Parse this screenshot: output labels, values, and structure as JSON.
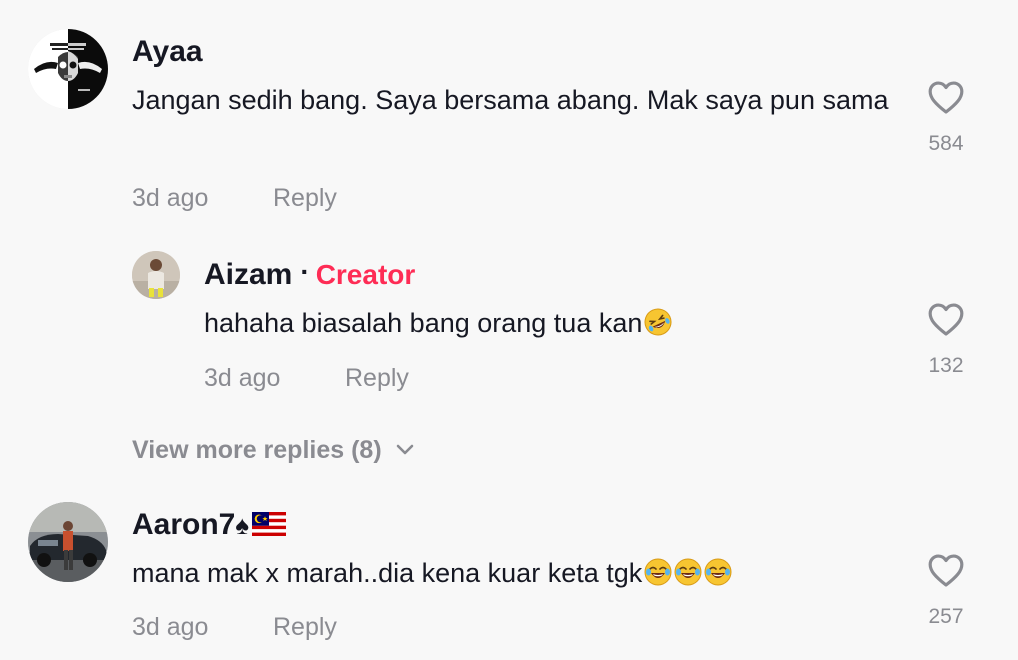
{
  "comments": [
    {
      "username": "Ayaa",
      "text": "Jangan sedih bang. Saya bersama abang. Mak saya pun sama",
      "time": "3d ago",
      "reply_label": "Reply",
      "likes": "584",
      "avatar_icon": "avenged-sevenfold-deathbat-avatar"
    },
    {
      "username": "Aizam",
      "separator": "·",
      "creator_label": "Creator",
      "text": "hahaha biasalah bang orang tua kan",
      "text_emojis": [
        "rolling-on-floor-laughing-emoji"
      ],
      "time": "3d ago",
      "reply_label": "Reply",
      "likes": "132",
      "avatar_icon": "person-photo-avatar"
    },
    {
      "username": "Aaron7",
      "username_suffix": "♠",
      "username_flag": "malaysia-flag-emoji",
      "text": "mana mak x marah..dia kena kuar keta tgk",
      "text_emojis": [
        "face-with-tears-of-joy-emoji",
        "face-with-tears-of-joy-emoji",
        "face-with-tears-of-joy-emoji"
      ],
      "time": "3d ago",
      "reply_label": "Reply",
      "likes": "257",
      "avatar_icon": "man-with-car-photo-avatar"
    }
  ],
  "view_more_replies": "View more replies (8)",
  "colors": {
    "background": "#f8f8f8",
    "primary_text": "#161823",
    "secondary_text": "#8a8b91",
    "creator_accent": "#fe2c55"
  }
}
